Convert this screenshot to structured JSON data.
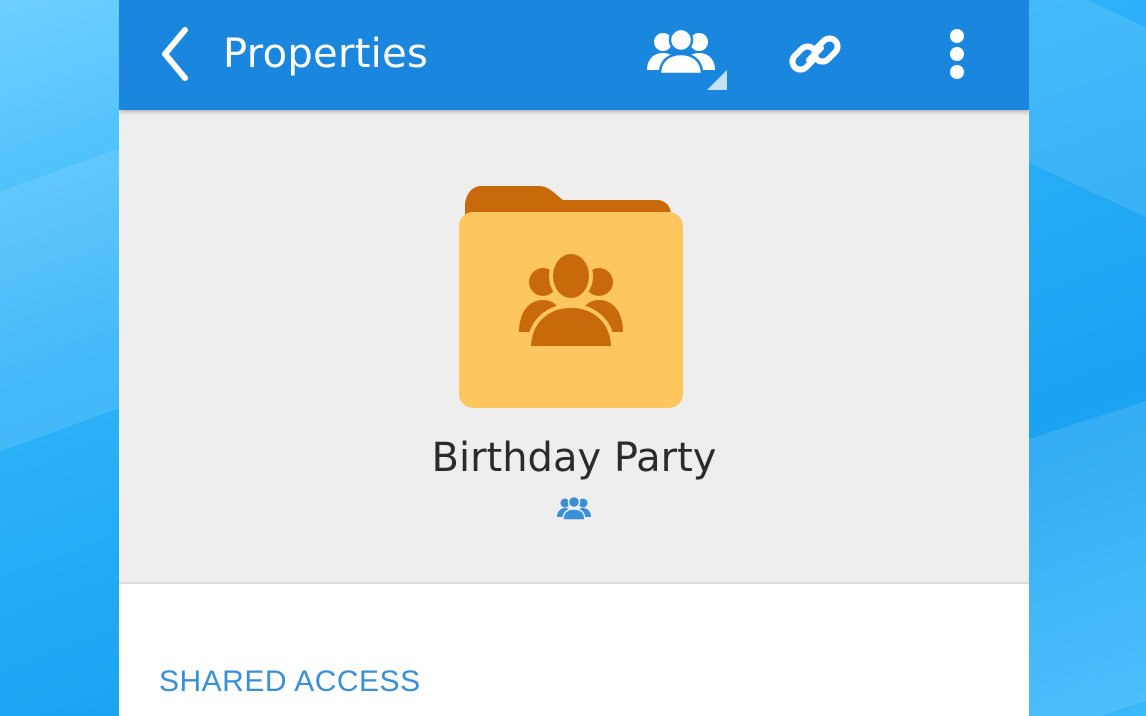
{
  "app_bar": {
    "title": "Properties",
    "back_icon": "chevron-left-icon",
    "share_icon": "people-group-icon",
    "link_icon": "link-icon",
    "more_icon": "more-vertical-icon",
    "color": "#1a86de"
  },
  "folder": {
    "name": "Birthday Party",
    "icon": "shared-folder-icon",
    "status_icon": "shared-people-icon",
    "folder_color": "#fec65e",
    "folder_tab_color": "#c8690a"
  },
  "sections": {
    "shared_access_title": "SHARED ACCESS"
  }
}
